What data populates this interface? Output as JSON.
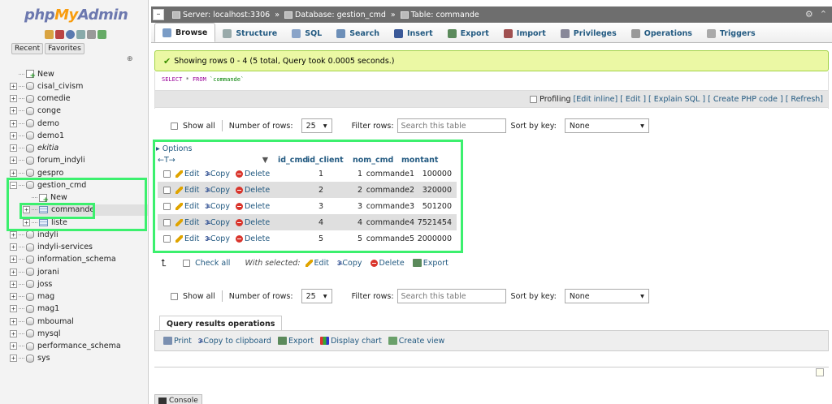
{
  "sidebar": {
    "logo": {
      "php": "php",
      "my": "My",
      "admin": "Admin"
    },
    "recent_label": "Recent",
    "favorites_label": "Favorites",
    "databases": [
      {
        "label": "New",
        "kind": "new"
      },
      {
        "label": "cisal_civism",
        "kind": "db"
      },
      {
        "label": "comedie",
        "kind": "db"
      },
      {
        "label": "conge",
        "kind": "db"
      },
      {
        "label": "demo",
        "kind": "db"
      },
      {
        "label": "demo1",
        "kind": "db"
      },
      {
        "label": "ekitia",
        "kind": "db",
        "italic": true
      },
      {
        "label": "forum_indyli",
        "kind": "db"
      },
      {
        "label": "gespro",
        "kind": "db"
      },
      {
        "label": "gestion_cmd",
        "kind": "db",
        "expanded": true
      },
      {
        "label": "New",
        "kind": "new-child"
      },
      {
        "label": "commande",
        "kind": "table-selected"
      },
      {
        "label": "liste",
        "kind": "table"
      },
      {
        "label": "indyli",
        "kind": "db"
      },
      {
        "label": "indyli-services",
        "kind": "db"
      },
      {
        "label": "information_schema",
        "kind": "db"
      },
      {
        "label": "jorani",
        "kind": "db"
      },
      {
        "label": "joss",
        "kind": "db"
      },
      {
        "label": "mag",
        "kind": "db"
      },
      {
        "label": "mag1",
        "kind": "db"
      },
      {
        "label": "mboumal",
        "kind": "db"
      },
      {
        "label": "mysql",
        "kind": "db"
      },
      {
        "label": "performance_schema",
        "kind": "db"
      },
      {
        "label": "sys",
        "kind": "db"
      }
    ]
  },
  "breadcrumb": {
    "server": "Server: localhost:3306",
    "database": "Database: gestion_cmd",
    "table": "Table: commande",
    "sep": "»"
  },
  "tabs": [
    {
      "label": "Browse",
      "icon": "browse-icon",
      "color": "#7a9cc6",
      "active": true
    },
    {
      "label": "Structure",
      "icon": "structure-icon",
      "color": "#9aa"
    },
    {
      "label": "SQL",
      "icon": "sql-icon",
      "color": "#8aa4c8"
    },
    {
      "label": "Search",
      "icon": "search-icon",
      "color": "#6d8fb8"
    },
    {
      "label": "Insert",
      "icon": "insert-icon",
      "color": "#3b5998"
    },
    {
      "label": "Export",
      "icon": "export-icon",
      "color": "#5b8a5b"
    },
    {
      "label": "Import",
      "icon": "import-icon",
      "color": "#a05050"
    },
    {
      "label": "Privileges",
      "icon": "privileges-icon",
      "color": "#889"
    },
    {
      "label": "Operations",
      "icon": "operations-icon",
      "color": "#999"
    },
    {
      "label": "Triggers",
      "icon": "triggers-icon",
      "color": "#aaa"
    }
  ],
  "success_msg": "Showing rows 0 - 4 (5 total, Query took 0.0005 seconds.)",
  "sql": {
    "select": "SELECT",
    "star": "*",
    "from": "FROM",
    "table": "`commande`"
  },
  "profiling": {
    "label": "Profiling",
    "edit_inline": "[Edit inline]",
    "edit": "[ Edit ]",
    "explain": "[ Explain SQL ]",
    "create_php": "[ Create PHP code ]",
    "refresh": "[ Refresh]"
  },
  "nav": {
    "show_all": "Show all",
    "num_rows_label": "Number of rows:",
    "num_rows_value": "25",
    "filter_label": "Filter rows:",
    "filter_placeholder": "Search this table",
    "sort_label": "Sort by key:",
    "sort_value": "None"
  },
  "options_label": "Options",
  "results": {
    "headers": [
      "id_cmd",
      "id_client",
      "nom_cmd",
      "montant"
    ],
    "actions": {
      "edit": "Edit",
      "copy": "Copy",
      "delete": "Delete"
    },
    "rows": [
      [
        "1",
        "1",
        "commande1",
        "100000"
      ],
      [
        "2",
        "2",
        "commande2",
        "320000"
      ],
      [
        "3",
        "3",
        "commande3",
        "501200"
      ],
      [
        "4",
        "4",
        "commande4",
        "7521454"
      ],
      [
        "5",
        "5",
        "commande5",
        "2000000"
      ]
    ]
  },
  "bulk": {
    "check_all": "Check all",
    "with_selected": "With selected:",
    "edit": "Edit",
    "copy": "Copy",
    "delete": "Delete",
    "export": "Export"
  },
  "qro": {
    "title": "Query results operations",
    "print": "Print",
    "copy_clip": "Copy to clipboard",
    "export": "Export",
    "display_chart": "Display chart",
    "create_view": "Create view"
  },
  "console_label": "Console",
  "colors": {
    "highlight": "#3cf06e",
    "success_bg": "#ebf8a4",
    "link": "#235a81"
  }
}
